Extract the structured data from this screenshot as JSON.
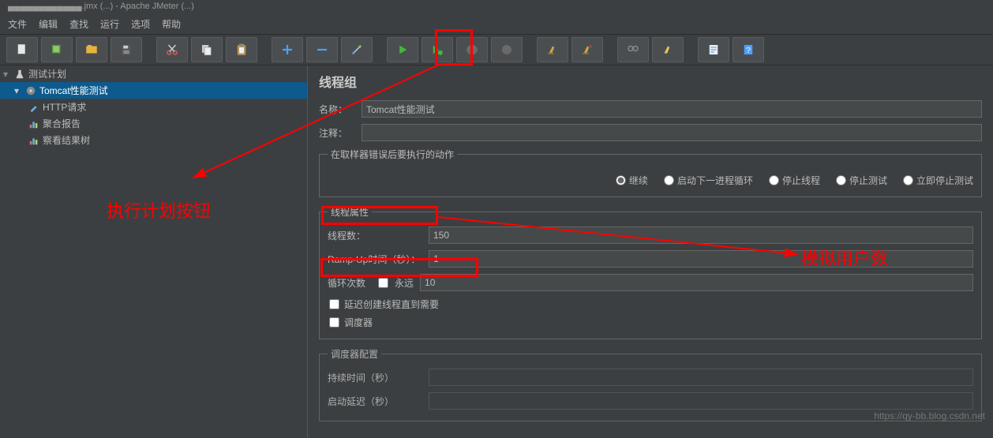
{
  "breadcrumb": "▄▄▄▄▄▄▄▄▄▄▄▄.jmx (...) - Apache JMeter (...)",
  "menu": {
    "file": "文件",
    "edit": "编辑",
    "search": "查找",
    "run": "运行",
    "options": "选项",
    "help": "帮助"
  },
  "tree": {
    "plan": "测试计划",
    "tg": "Tomcat性能测试",
    "http": "HTTP请求",
    "agg": "聚合报告",
    "viewtree": "察看结果树"
  },
  "panel": {
    "title": "线程组",
    "name_label": "名称：",
    "name_value": "Tomcat性能测试",
    "comment_label": "注释：",
    "comment_value": "",
    "error_legend": "在取样器错误后要执行的动作",
    "radios": {
      "cont": "继续",
      "next": "启动下一进程循环",
      "stopthread": "停止线程",
      "stoptest": "停止测试",
      "stopnow": "立即停止测试"
    },
    "thread_legend": "线程属性",
    "threads_label": "线程数：",
    "threads_value": "150",
    "ramp_label": "Ramp-Up时间（秒）：",
    "ramp_value": "1",
    "loop_label": "循环次数",
    "forever": "永远",
    "loop_value": "10",
    "delay_label": "延迟创建线程直到需要",
    "scheduler_label": "调度器",
    "sched_legend": "调度器配置",
    "duration_label": "持续时间（秒）",
    "startdelay_label": "启动延迟（秒）"
  },
  "annotations": {
    "exec": "执行计划按钮",
    "sim": "模拟用户数"
  },
  "watermark": "https://qy-bb.blog.csdn.net"
}
